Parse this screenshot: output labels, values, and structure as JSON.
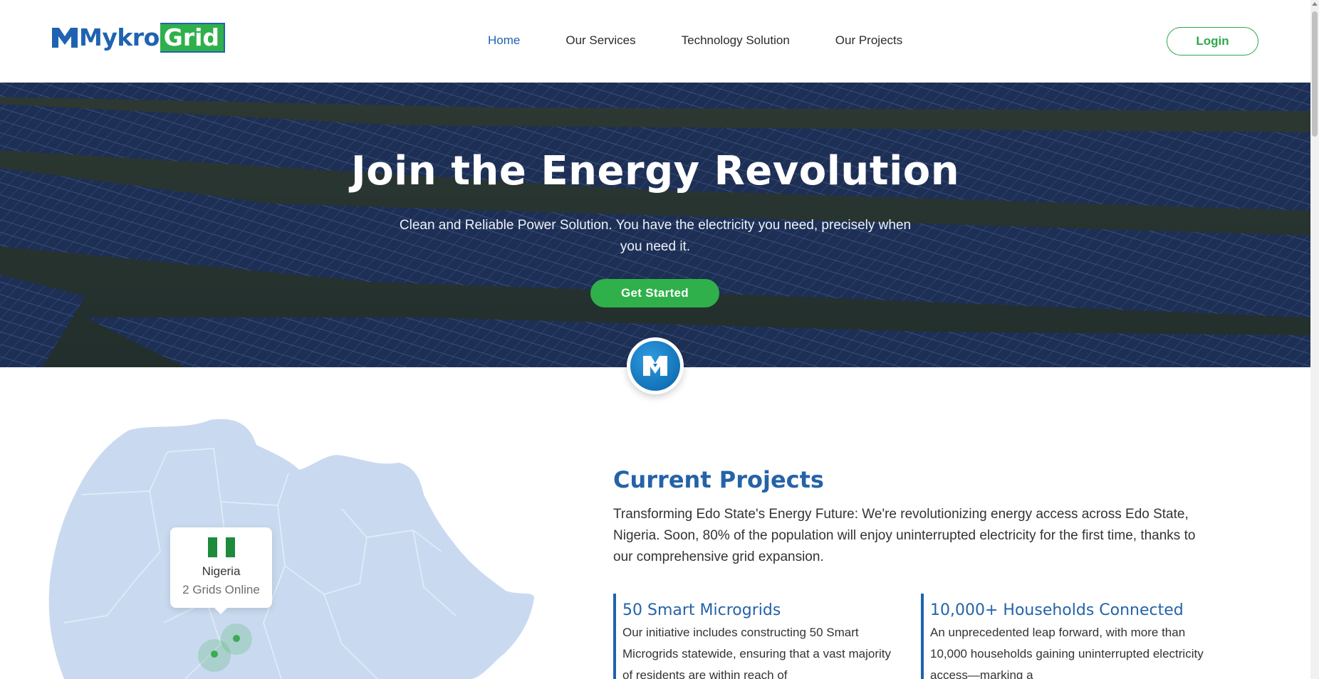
{
  "header": {
    "logo": {
      "word": "Mykro",
      "word_accent": "Grid"
    },
    "nav": [
      {
        "label": "Home",
        "active": true
      },
      {
        "label": "Our Services",
        "active": false
      },
      {
        "label": "Technology Solution",
        "active": false
      },
      {
        "label": "Our Projects",
        "active": false
      }
    ],
    "login_label": "Login"
  },
  "hero": {
    "title": "Join the Energy Revolution",
    "subtitle": "Clean and Reliable Power Solution. You have the electricity you need, precisely when you need it.",
    "cta_label": "Get Started"
  },
  "map": {
    "tooltip": {
      "country": "Nigeria",
      "status": "2 Grids Online"
    }
  },
  "projects": {
    "title": "Current Projects",
    "description": "Transforming Edo State's Energy Future: We're revolutionizing energy access across Edo State, Nigeria. Soon, 80% of the population will enjoy uninterrupted electricity for the first time, thanks to our comprehensive grid expansion.",
    "stats": [
      {
        "title": "50 Smart Microgrids",
        "text": "Our initiative includes constructing 50 Smart Microgrids statewide, ensuring that a vast majority of residents are within reach of"
      },
      {
        "title": "10,000+ Households Connected",
        "text": "An unprecedented leap forward, with more than 10,000 households gaining uninterrupted electricity access—marking a"
      }
    ]
  },
  "colors": {
    "brand_blue": "#1f63b0",
    "brand_green": "#2fb04b",
    "map_fill": "#c9daf0",
    "heading_blue": "#2563a8"
  },
  "icons": {
    "logo_mark": "mykrogrid-m-icon",
    "badge": "mykrogrid-badge-icon",
    "flag": "nigeria-flag-icon"
  }
}
